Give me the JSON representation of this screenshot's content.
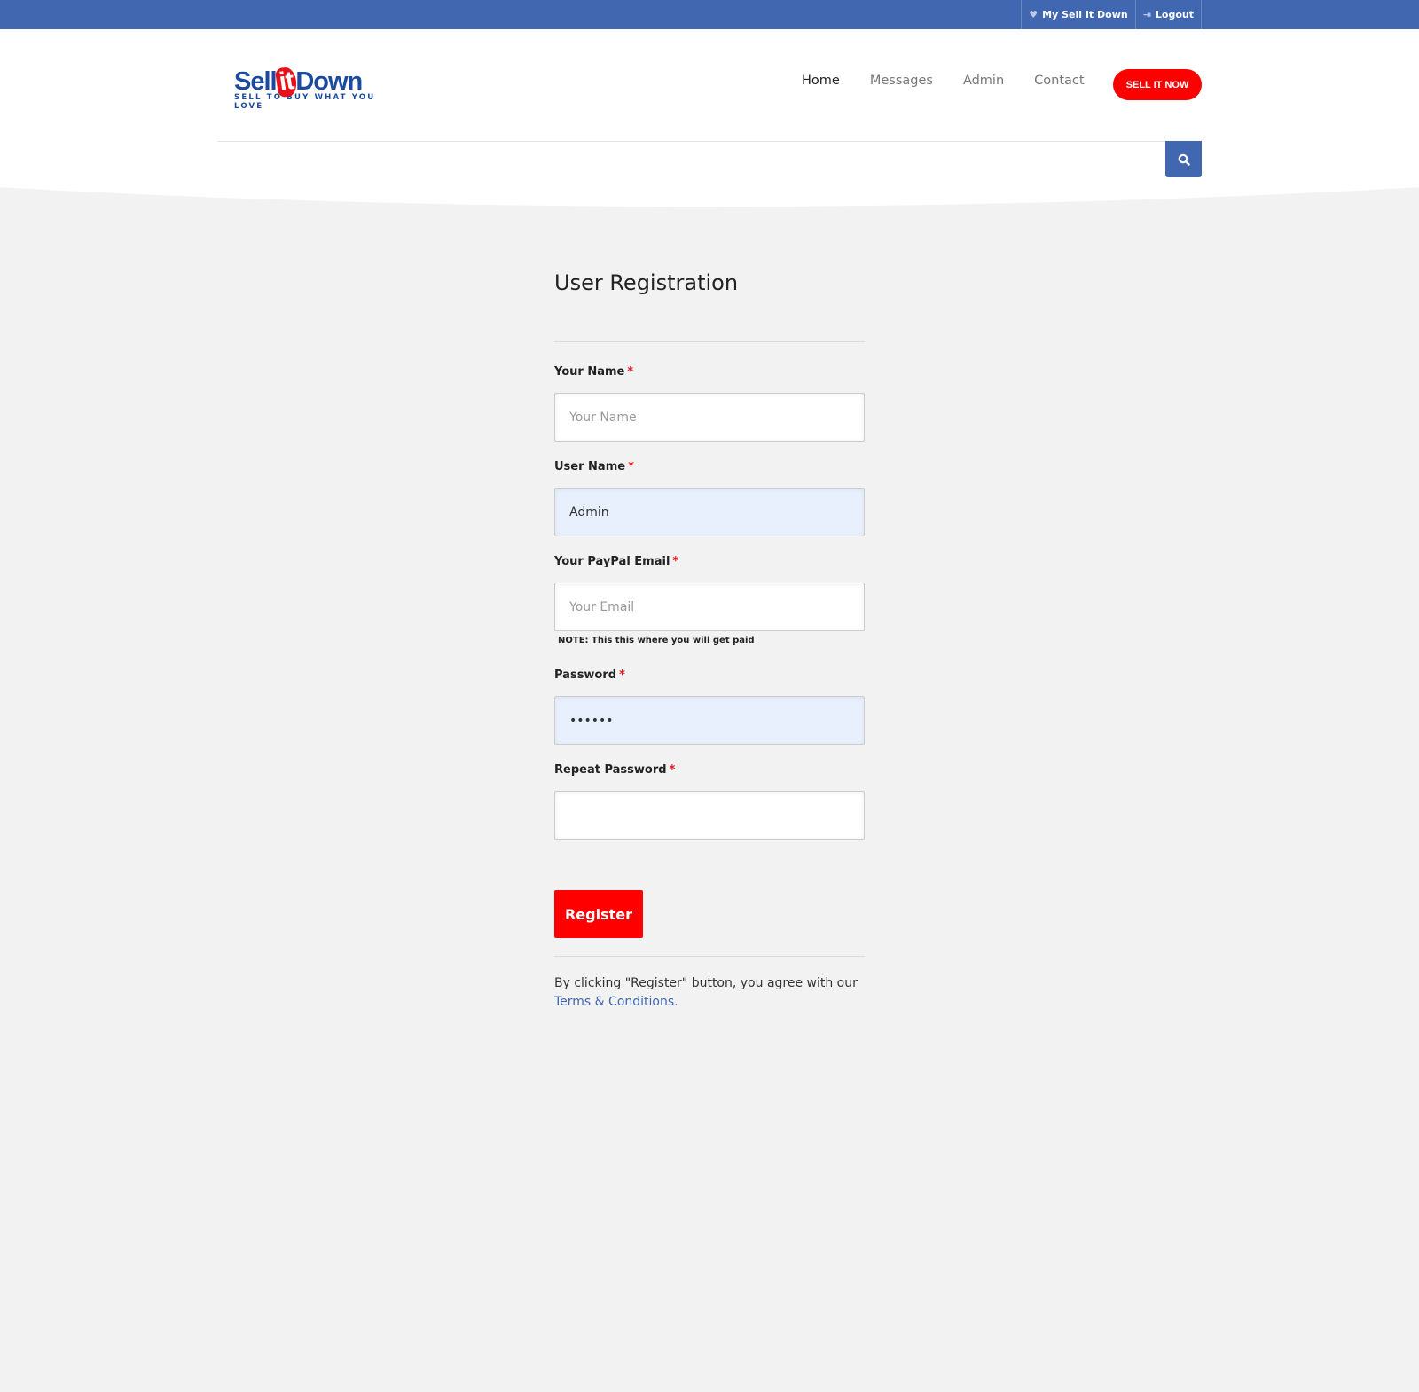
{
  "topbar": {
    "my_account": "My Sell It Down",
    "logout": "Logout"
  },
  "logo": {
    "text_sell": "Sell",
    "text_it": "it",
    "text_down": "Down",
    "tagline": "SELL TO BUY WHAT YOU LOVE"
  },
  "nav": {
    "items": [
      "Home",
      "Messages",
      "Admin",
      "Contact"
    ],
    "active": "Home",
    "cta": "SELL IT NOW"
  },
  "form": {
    "title": "User Registration",
    "fields": [
      {
        "label": "Your Name",
        "required": "*",
        "placeholder": "Your Name",
        "value": ""
      },
      {
        "label": "User Name",
        "required": "*",
        "placeholder": "",
        "value": "Admin"
      },
      {
        "label": "Your PayPal Email",
        "required": "*",
        "placeholder": "Your Email",
        "value": ""
      },
      {
        "label": "Password",
        "required": "*",
        "placeholder": "",
        "value": "••••••"
      },
      {
        "label": "Repeat Password",
        "required": "*",
        "placeholder": "",
        "value": ""
      }
    ],
    "email_note": "NOTE: This this where you will get paid",
    "submit": "Register",
    "agree_text": "By clicking \"Register\" button, you agree with our",
    "terms_link": "Terms & Conditions."
  },
  "colors": {
    "primary": "#4167b1",
    "accent": "#ff0000",
    "background": "#f2f2f2"
  }
}
